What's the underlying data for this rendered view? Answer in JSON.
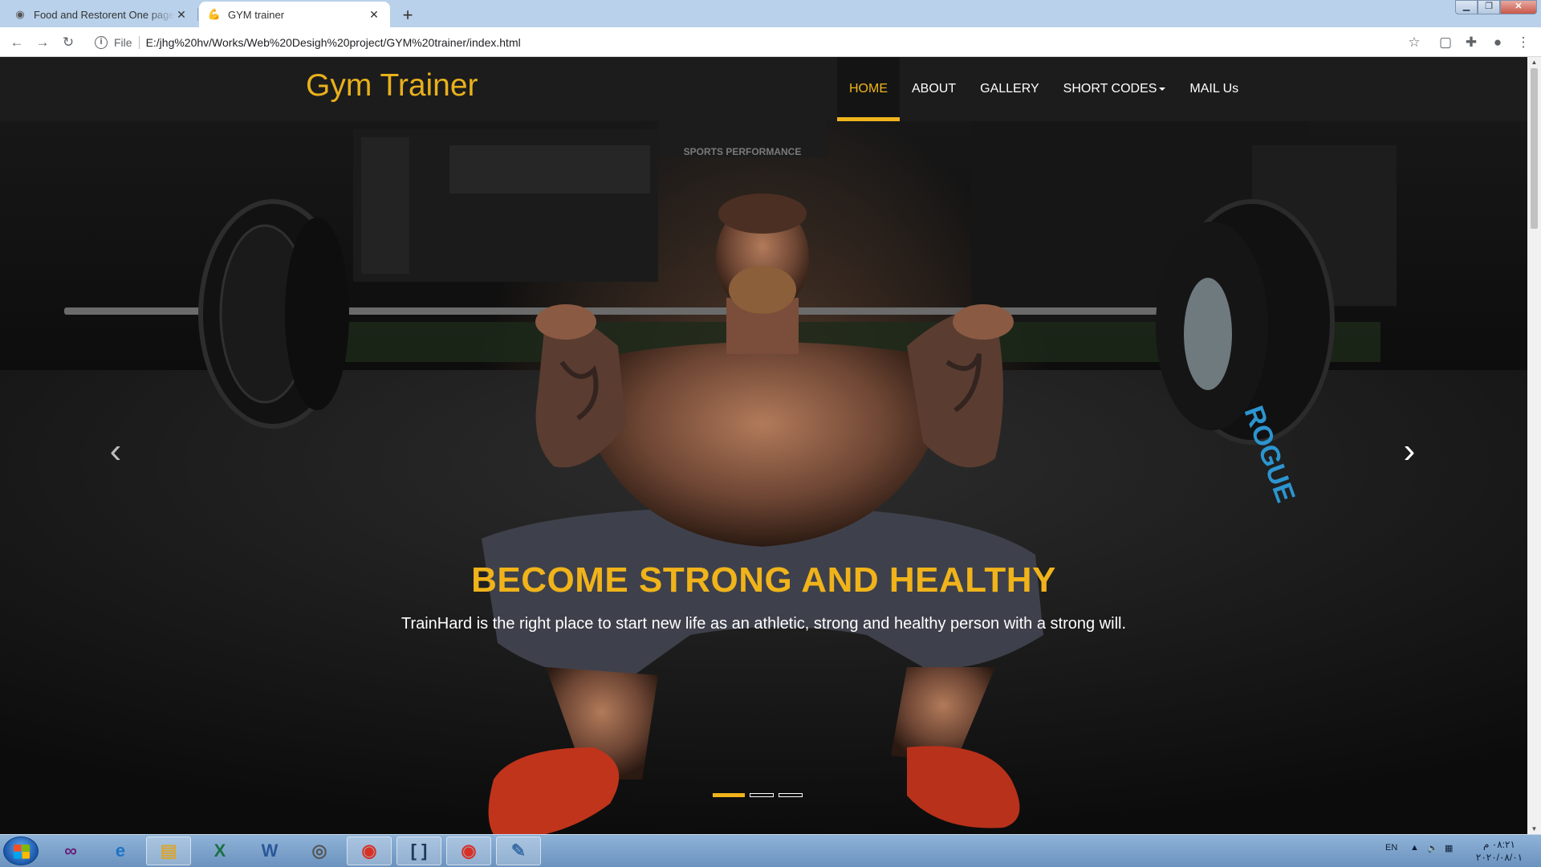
{
  "browser": {
    "tabs": [
      {
        "title": "Food and Restorent One page Te",
        "active": false,
        "icon": "chrome-favicon"
      },
      {
        "title": "GYM trainer",
        "active": true,
        "icon": "flexed-biceps-emoji"
      }
    ],
    "address": {
      "scheme_label": "File",
      "url": "E:/jhg%20hv/Works/Web%20Desigh%20project/GYM%20trainer/index.html"
    }
  },
  "site": {
    "brand": "Gym Trainer",
    "menu": [
      {
        "label": "HOME",
        "active": true
      },
      {
        "label": "ABOUT",
        "active": false
      },
      {
        "label": "GALLERY",
        "active": false
      },
      {
        "label": "SHORT CODES",
        "active": false,
        "dropdown": true
      },
      {
        "label": "MAIL Us",
        "active": false
      }
    ],
    "hero": {
      "heading": "BECOME STRONG AND HEALTHY",
      "subtext": "TrainHard is the right place to start new life as an athletic, strong and healthy person with a strong will.",
      "slides_count": 3,
      "active_slide": 1
    },
    "colors": {
      "accent": "#f0b31a",
      "navbar": "#1c1c1c",
      "text": "#ffffff"
    }
  },
  "taskbar": {
    "apps": [
      "visual-studio-icon",
      "internet-explorer-icon",
      "file-explorer-icon",
      "excel-icon",
      "word-icon",
      "media-icon",
      "chrome-icon",
      "brackets-icon",
      "chrome-icon",
      "paint-icon"
    ],
    "tray": {
      "language": "EN",
      "time": "٠٨:٢١ م",
      "date": "٢٠٢٠/٠٨/٠١"
    }
  }
}
